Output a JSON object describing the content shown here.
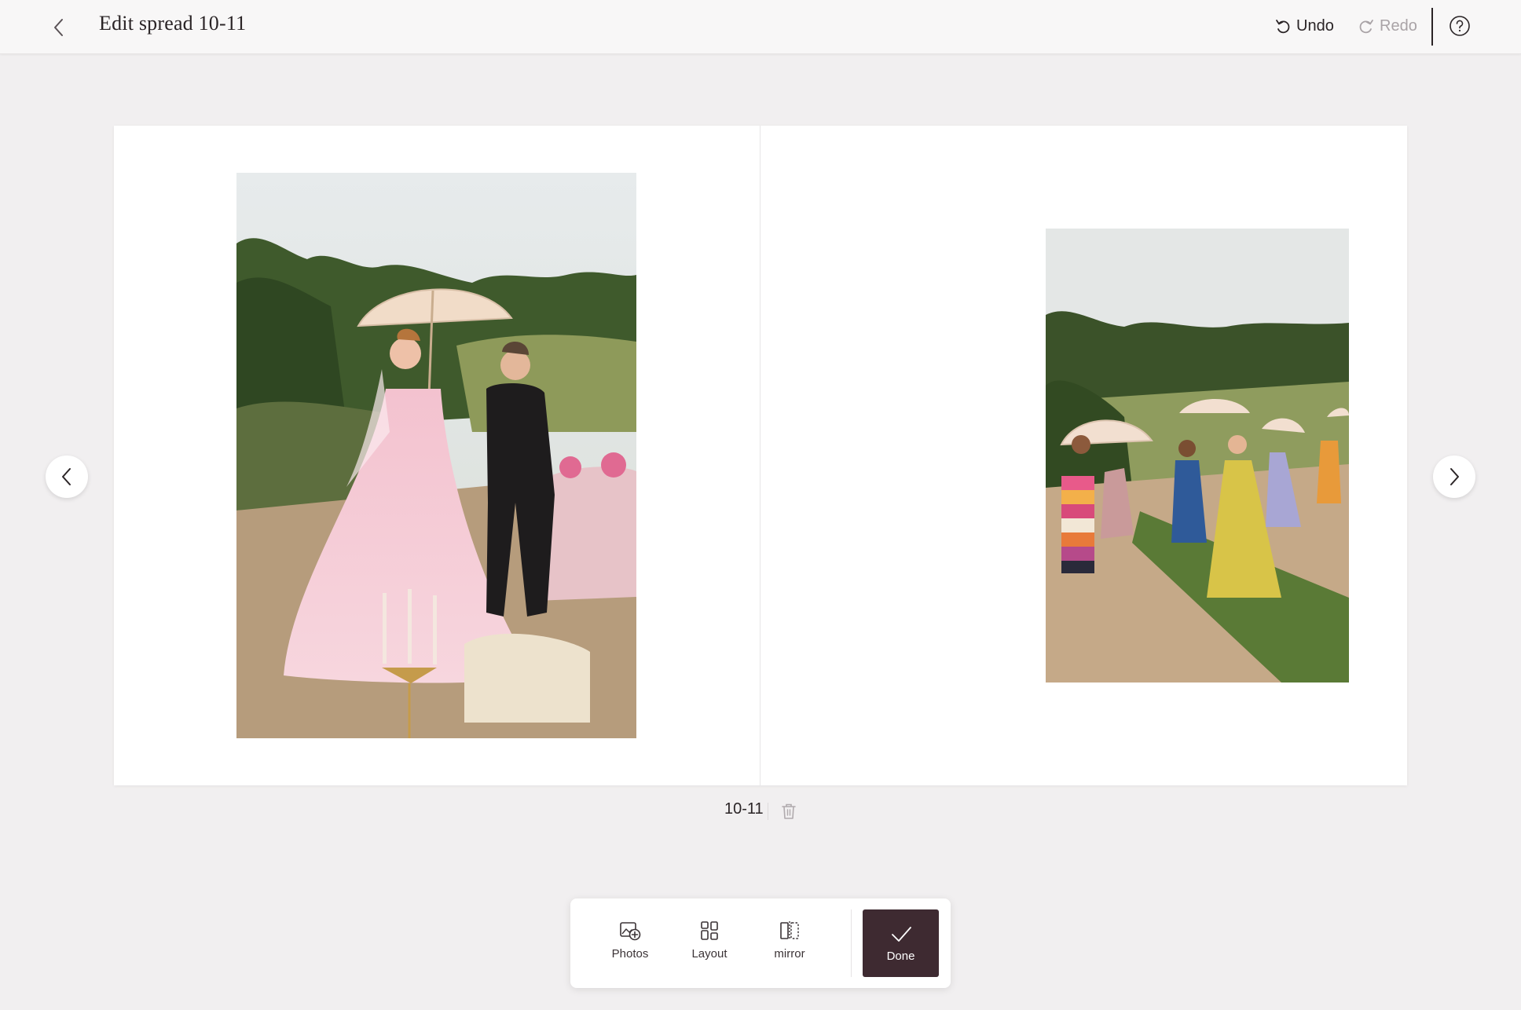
{
  "header": {
    "back_icon": "chevron-left-icon",
    "title": "Edit spread 10-11",
    "undo_label": "Undo",
    "redo_label": "Redo",
    "undo_icon": "undo-icon",
    "redo_icon": "redo-icon",
    "help_icon": "help-circle-icon"
  },
  "spread": {
    "label": "10-11",
    "delete_icon": "trash-icon",
    "prev_icon": "chevron-left-icon",
    "next_icon": "chevron-right-icon",
    "photos": [
      {
        "page": "left",
        "subject": "bride in pink gown and groom under parasol"
      },
      {
        "page": "right",
        "subject": "wedding guests with parasols walking on path"
      }
    ]
  },
  "toolbar": {
    "photos_label": "Photos",
    "layout_label": "Layout",
    "mirror_label": "mirror",
    "done_label": "Done",
    "photos_icon": "add-photo-icon",
    "layout_icon": "layout-grid-icon",
    "mirror_icon": "mirror-icon",
    "done_icon": "checkmark-icon"
  },
  "colors": {
    "background": "#f1eff0",
    "accent": "#3e2a31",
    "text": "#2a2426",
    "disabled": "#a9a3a6"
  }
}
